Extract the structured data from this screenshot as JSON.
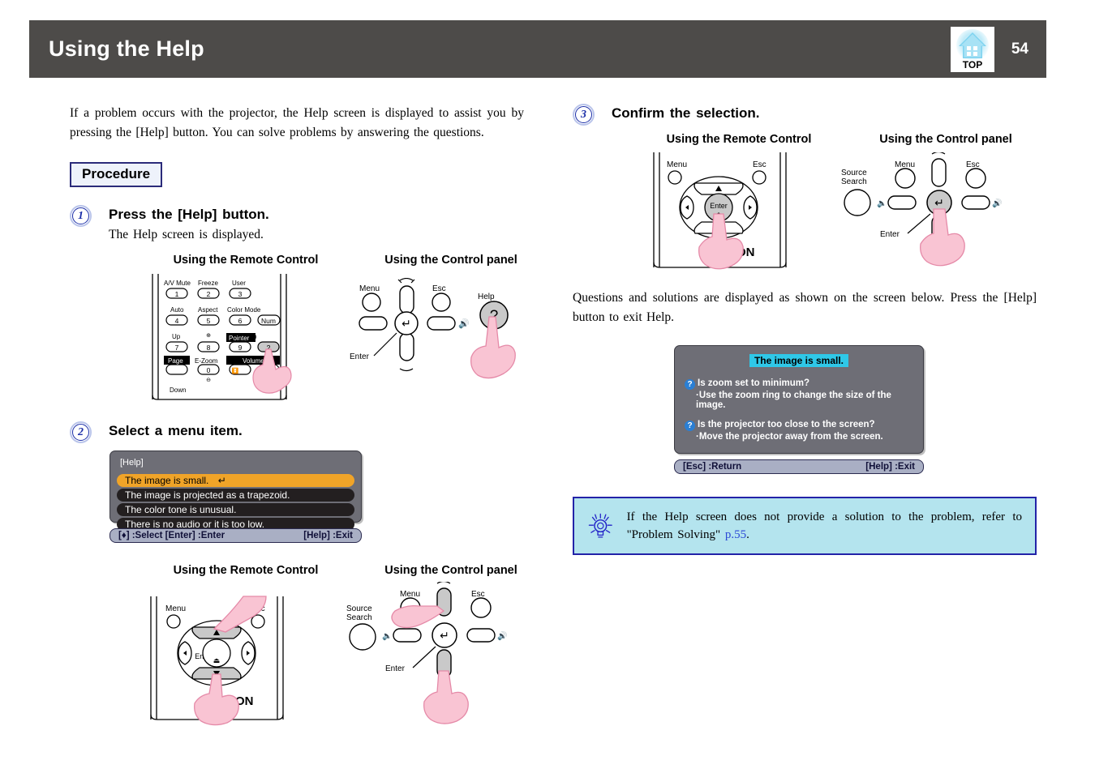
{
  "header": {
    "title": "Using the Help",
    "page_number": "54",
    "top_icon_label": "TOP",
    "bar_color": "#4d4b49"
  },
  "intro": {
    "paragraph": "If a problem occurs with the projector, the Help screen is displayed to assist you by pressing the [Help] button. You can solve problems by answering the questions."
  },
  "procedure": {
    "label": "Procedure"
  },
  "steps": [
    {
      "number": "1",
      "title": "Press the [Help] button.",
      "subtitle": "The Help screen is displayed.",
      "caption_remote": "Using the Remote Control",
      "caption_panel": "Using the Control panel"
    },
    {
      "number": "2",
      "title": "Select a menu item.",
      "caption_remote": "Using the Remote Control",
      "caption_panel": "Using the Control panel"
    },
    {
      "number": "3",
      "title": "Confirm the selection.",
      "caption_remote": "Using the Remote Control",
      "caption_panel": "Using the Control panel",
      "body": "Questions and solutions are displayed as shown on the screen below. Press the [Help] button to exit Help."
    }
  ],
  "remote_keys": {
    "row1_labels": [
      "A/V Mute",
      "Freeze",
      "User"
    ],
    "row1_numbers": [
      "1",
      "2",
      "3"
    ],
    "row2_labels": [
      "Auto",
      "Aspect",
      "Color Mode"
    ],
    "row2_numbers": [
      "4",
      "5",
      "6"
    ],
    "num_label": "Num",
    "row3_labels": [
      "Up",
      "",
      "Pointer",
      "Help"
    ],
    "row3_numbers": [
      "7",
      "8",
      "9",
      "?"
    ],
    "row4_labels": [
      "Page",
      "E-Zoom",
      "Volume"
    ],
    "row4_numbers": [
      "",
      "0",
      ""
    ],
    "down_label": "Down",
    "menu_label": "Menu",
    "esc_label": "Esc",
    "enter_label": "Enter",
    "brand": "ON"
  },
  "panel_keys": {
    "menu_label": "Menu",
    "esc_label": "Esc",
    "help_label": "Help",
    "enter_label": "Enter",
    "source_search_label": "Source\nSearch",
    "help_glyph": "?"
  },
  "help_menu_osd": {
    "title": "[Help]",
    "items": [
      "The image is small.",
      "The image is projected as a trapezoid.",
      "The color tone is unusual.",
      "There is no audio or it is too low."
    ],
    "selected_index": 0,
    "status_left": "[♦] :Select  [Enter] :Enter",
    "status_right": "[Help] :Exit",
    "highlight_color": "#f0a428"
  },
  "help_solution_osd": {
    "title": "The image is small.",
    "entries": [
      {
        "question": "Is zoom set to minimum?",
        "solution": "·Use the zoom ring to change the size of the image."
      },
      {
        "question": "Is the projector too close to the screen?",
        "solution": "·Move the projector away from the screen."
      }
    ],
    "status_left": "[Esc] :Return",
    "status_right": "[Help] :Exit",
    "highlight_color": "#2fc8e8"
  },
  "tip": {
    "text": "If the Help screen does not provide a solution to the problem, refer to \"Problem Solving\" ",
    "link": "p.55",
    "suffix": ".",
    "bg_color": "#b4e4ee",
    "border_color": "#2323a8"
  }
}
